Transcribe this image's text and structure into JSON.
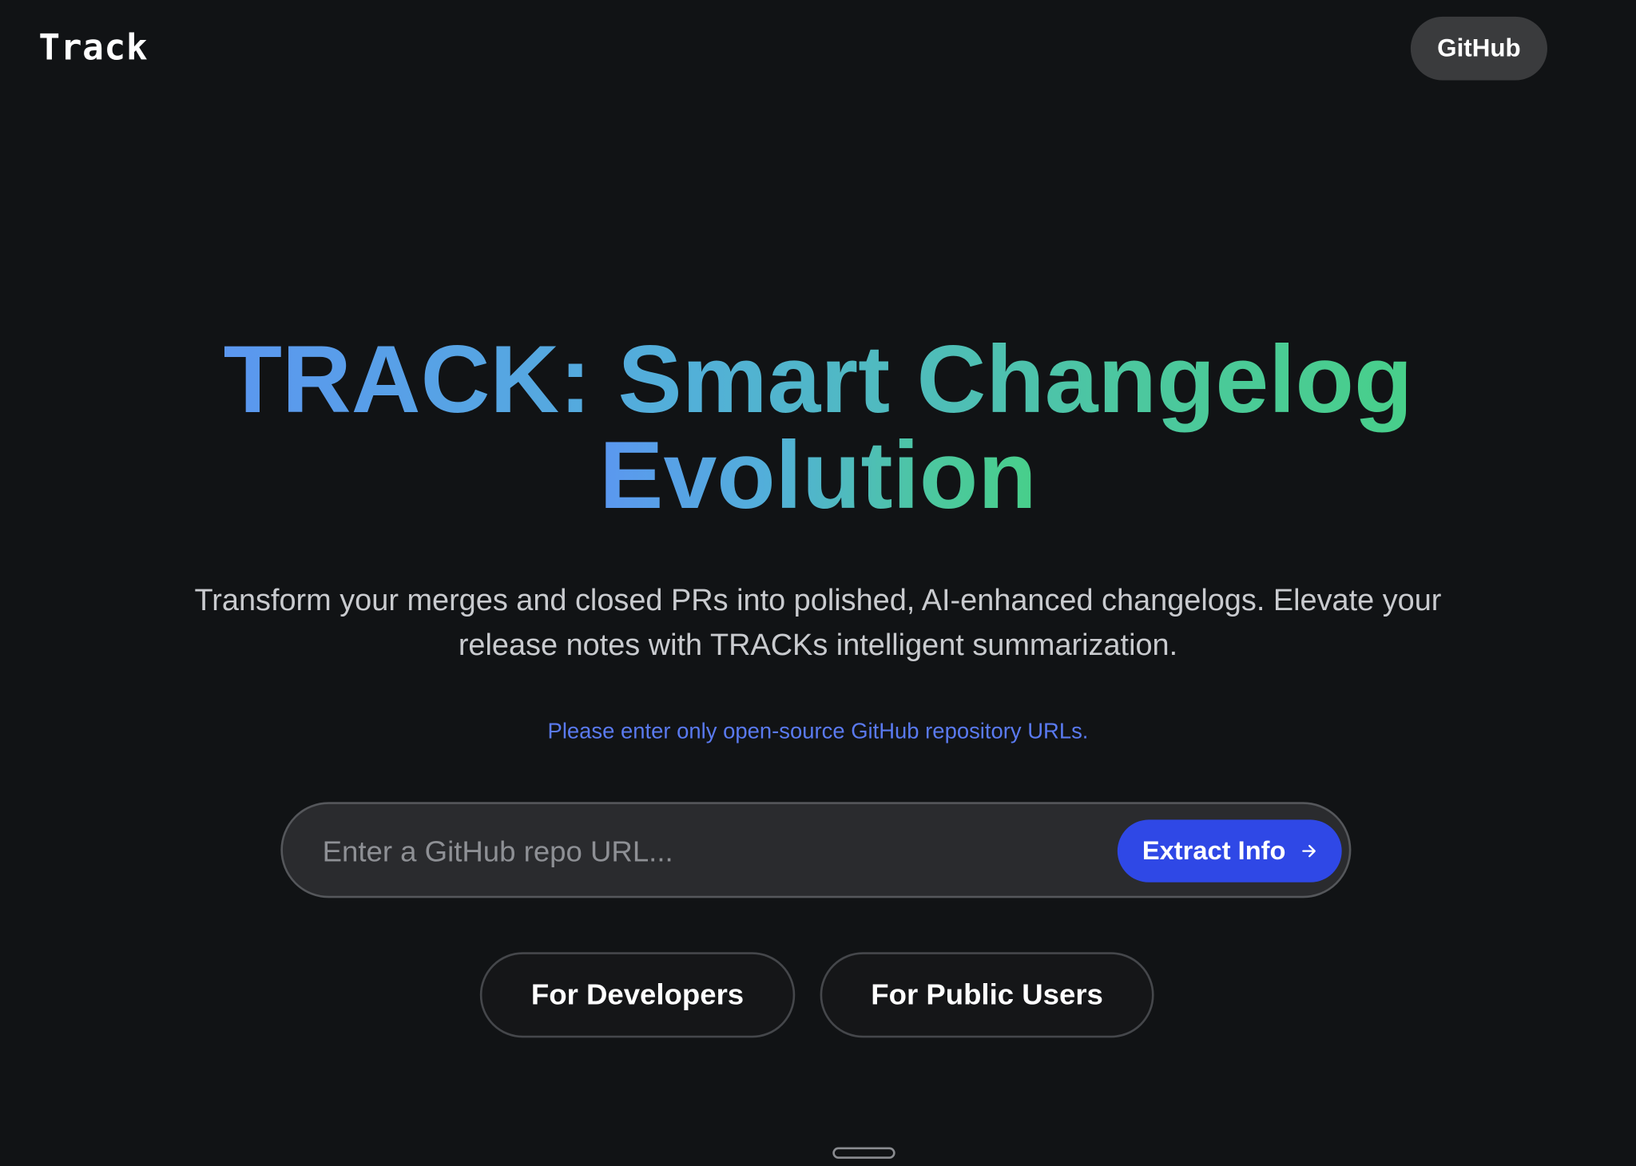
{
  "header": {
    "logo_text": "Track",
    "github_label": "GitHub"
  },
  "hero": {
    "title_line1": "TRACK: Smart Changelog",
    "title_line2": "Evolution",
    "subtitle": "Transform your merges and closed PRs into polished, AI-enhanced changelogs. Elevate your release notes with TRACKs intelligent summarization.",
    "notice": "Please enter only open-source GitHub repository URLs."
  },
  "search": {
    "placeholder": "Enter a GitHub repo URL...",
    "value": "",
    "button_label": "Extract Info",
    "button_icon": "arrow-right-icon"
  },
  "audience_buttons": [
    {
      "label": "For Developers"
    },
    {
      "label": "For Public Users"
    }
  ],
  "colors": {
    "background": "#111315",
    "accent": "#2f48e6",
    "gradient_start": "#5b97f0",
    "gradient_end": "#48cf8a",
    "notice": "#5a7af0"
  }
}
